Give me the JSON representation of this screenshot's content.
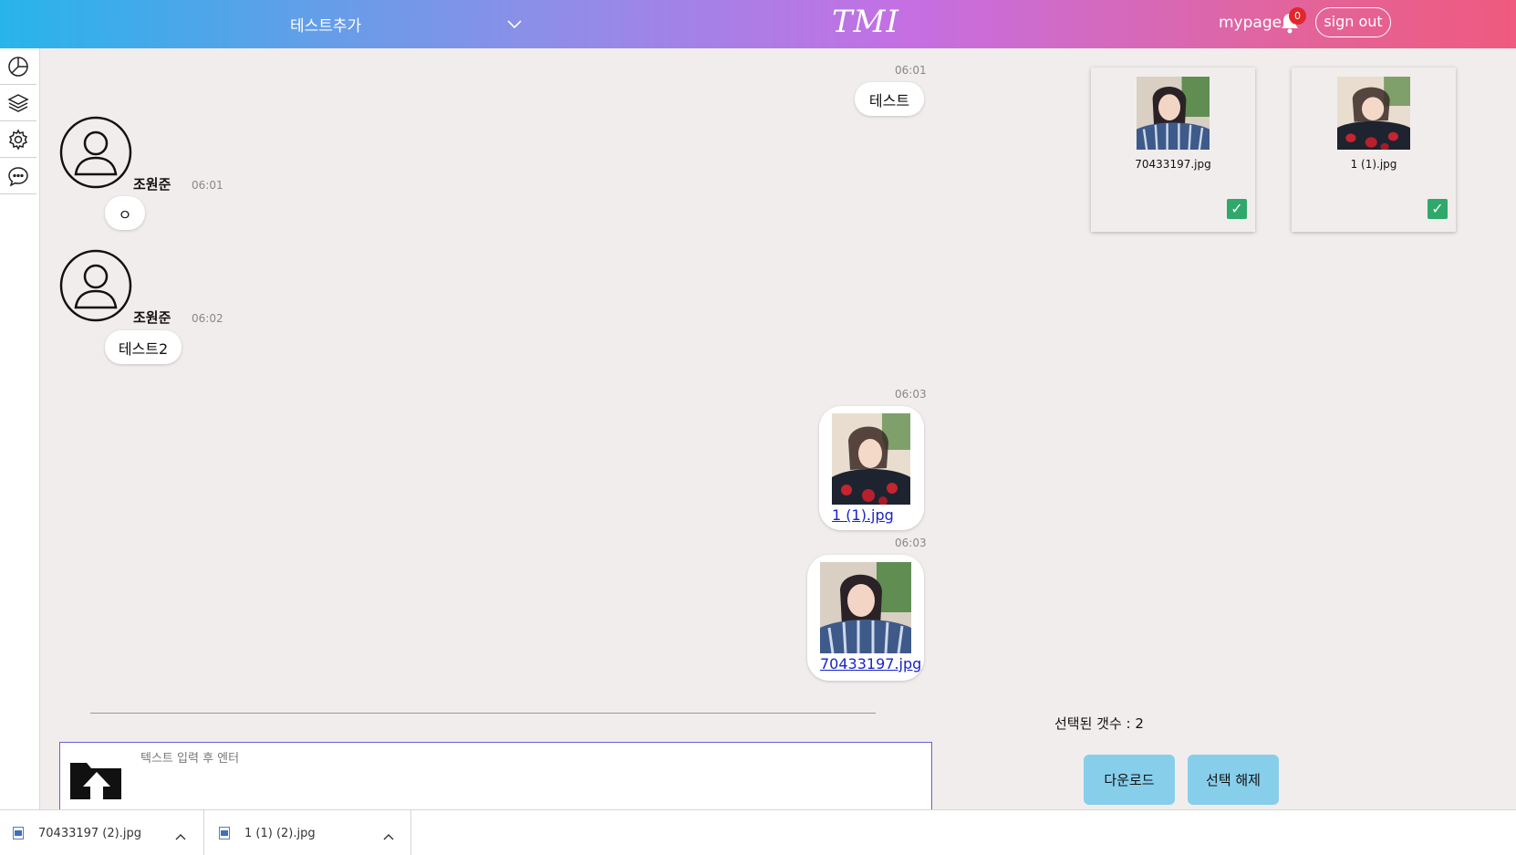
{
  "header": {
    "room_name": "테스트추가",
    "logo": "TMI",
    "mypage": "mypage",
    "notification_count": "0",
    "signout": "sign out"
  },
  "sidebar": {
    "items": [
      "chart-icon",
      "layers-icon",
      "gear-icon",
      "chat-icon"
    ]
  },
  "messages": {
    "m1": {
      "time": "06:01",
      "text": "테스트"
    },
    "m2": {
      "sender": "조원준",
      "time": "06:01",
      "text": "ㅇ"
    },
    "m3": {
      "sender": "조원준",
      "time": "06:02",
      "text": "테스트2"
    },
    "m4": {
      "time": "06:03",
      "file": "1 (1).jpg"
    },
    "m5": {
      "time": "06:03",
      "file": "70433197.jpg"
    }
  },
  "composer": {
    "placeholder": "텍스트 입력 후 엔터"
  },
  "gallery": {
    "files": [
      {
        "name": "70433197.jpg",
        "checked": true
      },
      {
        "name": "1 (1).jpg",
        "checked": true
      }
    ],
    "check_mark": "✓",
    "selected_label": "선택된 갯수 : 2",
    "download": "다운로드",
    "deselect": "선택 해제"
  },
  "downloads": [
    {
      "name": "70433197 (2).jpg"
    },
    {
      "name": "1 (1) (2).jpg"
    }
  ],
  "colors": {
    "header_start": "#28b4ea",
    "header_end": "#ef5a7e",
    "button": "#87ceeb",
    "check": "#2fa86b",
    "badge": "#e3262c"
  }
}
